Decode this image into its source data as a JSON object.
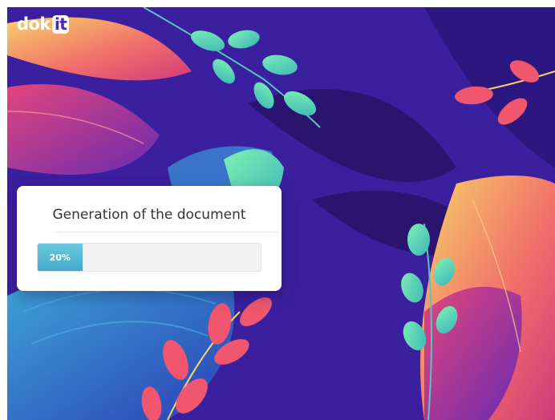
{
  "brand": {
    "logo_prefix": "dok",
    "logo_boxed": "it"
  },
  "icons": [
    "leaf-illustration"
  ],
  "dialog": {
    "title": "Generation of the document",
    "progress": {
      "label": "20%",
      "fraction": 0.2,
      "fill_color": "#4fb7d6"
    }
  },
  "colors": {
    "background": "#3a1f9e",
    "accent_pink": "#f0566e",
    "accent_teal": "#5fd3b7",
    "accent_yellow": "#f6d36a"
  }
}
